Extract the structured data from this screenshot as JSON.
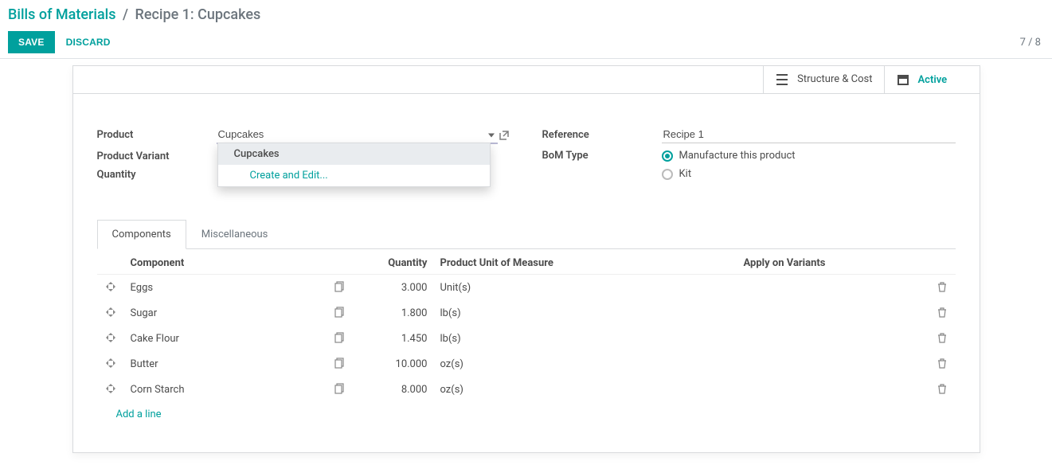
{
  "breadcrumb": {
    "root": "Bills of Materials",
    "sep": "/",
    "current": "Recipe 1: Cupcakes"
  },
  "toolbar": {
    "save": "SAVE",
    "discard": "DISCARD",
    "pager": "7 / 8"
  },
  "stat_buttons": {
    "structure_cost": "Structure & Cost",
    "active": "Active"
  },
  "form": {
    "product_label": "Product",
    "product_value": "Cupcakes",
    "variant_label": "Product Variant",
    "qty_label": "Quantity",
    "reference_label": "Reference",
    "reference_value": "Recipe 1",
    "bom_type_label": "BoM Type",
    "bom_type_opt1": "Manufacture this product",
    "bom_type_opt2": "Kit"
  },
  "dropdown": {
    "option1": "Cupcakes",
    "create_edit": "Create and Edit..."
  },
  "tabs": {
    "components": "Components",
    "misc": "Miscellaneous"
  },
  "table": {
    "headers": {
      "component": "Component",
      "quantity": "Quantity",
      "uom": "Product Unit of Measure",
      "variants": "Apply on Variants"
    },
    "rows": [
      {
        "name": "Eggs",
        "qty": "3.000",
        "uom": "Unit(s)"
      },
      {
        "name": "Sugar",
        "qty": "1.800",
        "uom": "lb(s)"
      },
      {
        "name": "Cake Flour",
        "qty": "1.450",
        "uom": "lb(s)"
      },
      {
        "name": "Butter",
        "qty": "10.000",
        "uom": "oz(s)"
      },
      {
        "name": "Corn Starch",
        "qty": "8.000",
        "uom": "oz(s)"
      }
    ],
    "add_line": "Add a line"
  }
}
